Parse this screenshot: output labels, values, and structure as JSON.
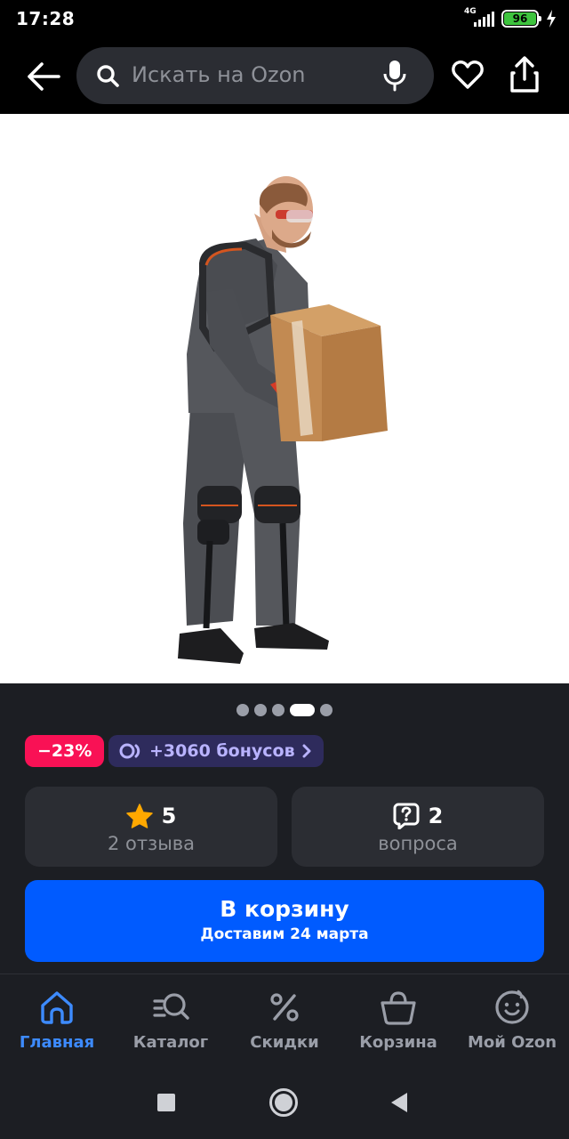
{
  "status_bar": {
    "time": "17:28",
    "network_label": "4G",
    "battery_percent": "96",
    "battery_color": "#3ec43e"
  },
  "app_bar": {
    "back_icon": "arrow-left-icon",
    "search_placeholder": "Искать на Ozon",
    "mic_icon": "microphone-icon",
    "favorite_icon": "heart-icon",
    "share_icon": "share-icon"
  },
  "gallery": {
    "total_images": 5,
    "active_index": 3
  },
  "badges": {
    "discount": "−23%",
    "bonus": "+3060 бонусов"
  },
  "rating": {
    "score": "5",
    "reviews": "2 отзыва"
  },
  "questions": {
    "count": "2",
    "label": "вопроса"
  },
  "cart": {
    "button_label": "В корзину",
    "delivery": "Доставим 24 марта",
    "color": "#005bff"
  },
  "bottom_nav": {
    "items": [
      {
        "label": "Главная",
        "icon": "home-icon",
        "active": true
      },
      {
        "label": "Каталог",
        "icon": "catalog-search-icon",
        "active": false
      },
      {
        "label": "Скидки",
        "icon": "percent-icon",
        "active": false
      },
      {
        "label": "Корзина",
        "icon": "basket-icon",
        "active": false
      },
      {
        "label": "Мой Ozon",
        "icon": "smile-face-icon",
        "active": false
      }
    ],
    "active_color": "#3d8bff"
  }
}
